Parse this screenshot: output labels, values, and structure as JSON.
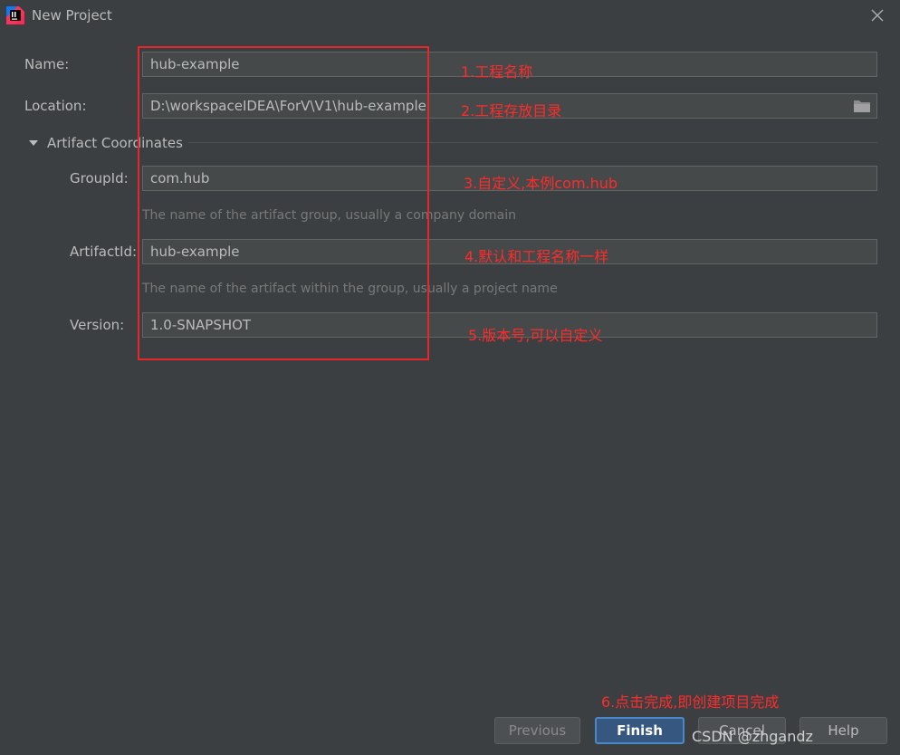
{
  "window": {
    "title": "New Project",
    "icon": "intellij-idea-icon"
  },
  "form": {
    "name": {
      "label": "Name:",
      "value": "hub-example"
    },
    "location": {
      "label": "Location:",
      "value": "D:\\workspaceIDEA\\ForV\\V1\\hub-example",
      "icon": "folder-icon"
    },
    "section": {
      "title": "Artifact Coordinates",
      "expanded": true
    },
    "group_id": {
      "label": "GroupId:",
      "value": "com.hub",
      "hint": "The name of the artifact group, usually a company domain"
    },
    "artifact_id": {
      "label": "ArtifactId:",
      "value": "hub-example",
      "hint": "The name of the artifact within the group, usually a project name"
    },
    "version": {
      "label": "Version:",
      "value": "1.0-SNAPSHOT"
    }
  },
  "annotations": {
    "note1": "1.工程名称",
    "note2": "2.工程存放目录",
    "note3": "3.自定义,本例com.hub",
    "note4": "4.默认和工程名称一样",
    "note5": "5.版本号,可以自定义",
    "note6": "6.点击完成,即创建项目完成",
    "color": "#ff2b2b"
  },
  "buttons": {
    "previous": "Previous",
    "finish": "Finish",
    "cancel": "Cancel",
    "help": "Help"
  },
  "watermark": "CSDN @zhgandz",
  "colors": {
    "background": "#3c3f41",
    "field": "#45494a",
    "primary": "#365880",
    "primary_border": "#4a88c7"
  }
}
